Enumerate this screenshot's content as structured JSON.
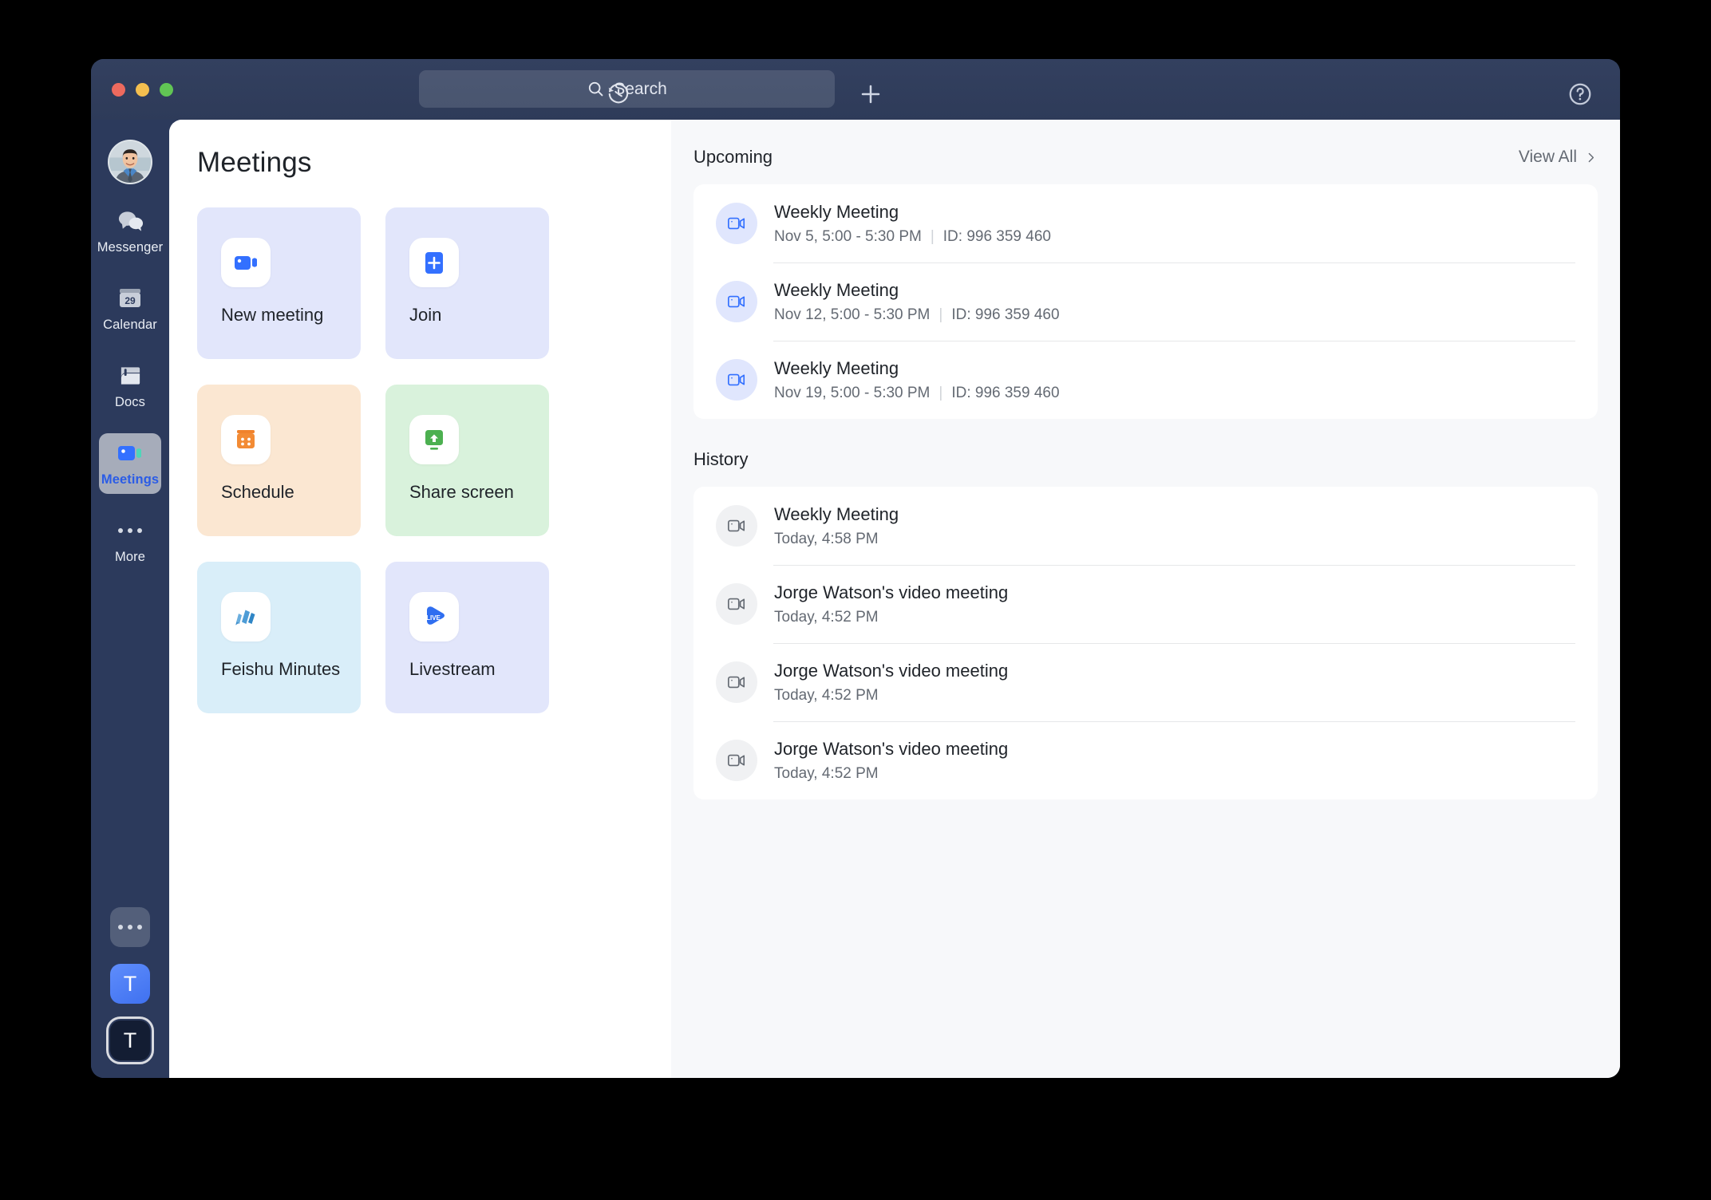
{
  "window": {
    "traffic_lights": [
      "close",
      "minimize",
      "maximize"
    ]
  },
  "titlebar": {
    "history_icon": "history-clock-icon",
    "search_placeholder": "Search",
    "search_icon": "search-icon",
    "plus_icon": "plus-icon",
    "help_icon": "help-circle-icon"
  },
  "rail": {
    "avatar_name": "user-avatar",
    "items": [
      {
        "label": "Messenger",
        "icon": "chat-bubbles-icon",
        "active": false
      },
      {
        "label": "Calendar",
        "icon": "calendar-29-icon",
        "active": false,
        "day": "29"
      },
      {
        "label": "Docs",
        "icon": "docs-icon",
        "active": false
      },
      {
        "label": "Meetings",
        "icon": "video-camera-icon",
        "active": true
      },
      {
        "label": "More",
        "icon": "ellipsis-icon",
        "active": false
      }
    ],
    "bottom_tiles": [
      {
        "name": "more-apps-tile",
        "glyph": "•••"
      },
      {
        "name": "workspace-tile-1",
        "glyph": "T"
      },
      {
        "name": "workspace-tile-2",
        "glyph": "T"
      }
    ]
  },
  "main": {
    "page_title": "Meetings",
    "tiles": [
      {
        "label": "New meeting",
        "icon": "video-camera-icon",
        "color": "c-indigo"
      },
      {
        "label": "Join",
        "icon": "plus-square-icon",
        "color": "c-indigo"
      },
      {
        "label": "Schedule",
        "icon": "calendar-icon",
        "color": "c-peach"
      },
      {
        "label": "Share screen",
        "icon": "screen-share-icon",
        "color": "c-green"
      },
      {
        "label": "Feishu Minutes",
        "icon": "minutes-icon",
        "color": "c-sky"
      },
      {
        "label": "Livestream",
        "icon": "live-play-icon",
        "color": "c-indigo"
      }
    ]
  },
  "upcoming": {
    "title": "Upcoming",
    "view_all": "View All",
    "chevron_icon": "chevron-right-icon",
    "items": [
      {
        "title": "Weekly Meeting",
        "time": "Nov 5, 5:00 - 5:30 PM",
        "id": "ID: 996 359 460",
        "icon": "video-camera-outline-icon"
      },
      {
        "title": "Weekly Meeting",
        "time": "Nov 12, 5:00 - 5:30 PM",
        "id": "ID: 996 359 460",
        "icon": "video-camera-outline-icon"
      },
      {
        "title": "Weekly Meeting",
        "time": "Nov 19, 5:00 - 5:30 PM",
        "id": "ID: 996 359 460",
        "icon": "video-camera-outline-icon"
      }
    ]
  },
  "history": {
    "title": "History",
    "items": [
      {
        "title": "Weekly Meeting",
        "time": "Today, 4:58 PM",
        "icon": "video-camera-outline-icon"
      },
      {
        "title": "Jorge Watson's video meeting",
        "time": "Today, 4:52 PM",
        "icon": "video-camera-outline-icon"
      },
      {
        "title": "Jorge Watson's video meeting",
        "time": "Today, 4:52 PM",
        "icon": "video-camera-outline-icon"
      },
      {
        "title": "Jorge Watson's video meeting",
        "time": "Today, 4:52 PM",
        "icon": "video-camera-outline-icon"
      }
    ]
  },
  "colors": {
    "window_chrome": "#2c3a5c",
    "accent_blue": "#3370ff",
    "tile_indigo": "#e2e6fb",
    "tile_peach": "#fbe7d2",
    "tile_green": "#d9f2dc",
    "tile_sky": "#d9eef9",
    "text_primary": "#1f2329",
    "text_secondary": "#646a73"
  }
}
